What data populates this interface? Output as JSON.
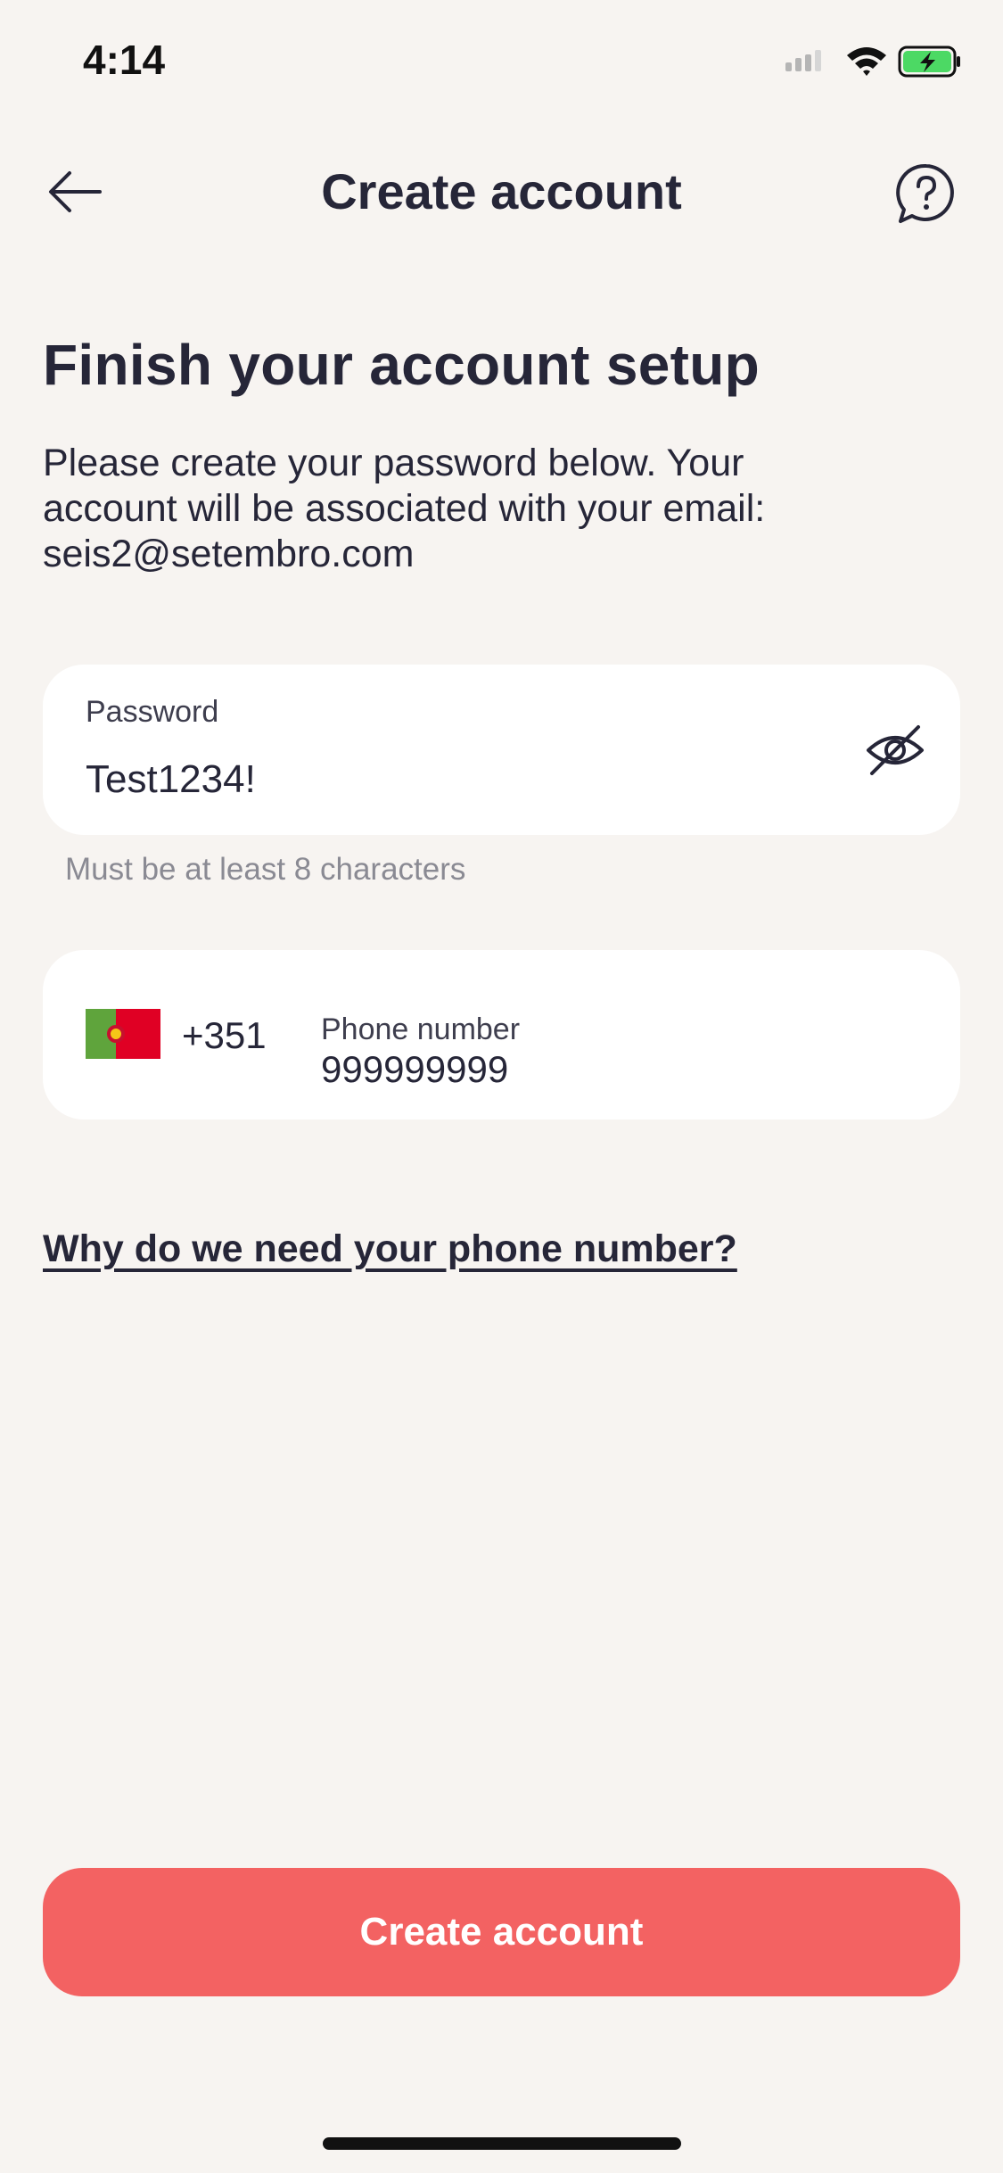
{
  "status_bar": {
    "time": "4:14",
    "icons": [
      "cellular-signal-icon",
      "wifi-icon",
      "battery-charging-icon"
    ]
  },
  "nav": {
    "title": "Create account",
    "back_icon": "arrow-left-icon",
    "help_icon": "help-bubble-icon"
  },
  "heading": "Finish your account setup",
  "intro": {
    "line1": "Please create your password below. Your",
    "line2": "account will be associated with your email:",
    "line3": "seis2@setembro.com"
  },
  "password_field": {
    "label": "Password",
    "value": "Test1234!",
    "visibility_icon": "eye-off-icon",
    "hint": "Must be at least 8 characters"
  },
  "phone_field": {
    "country_flag": "portugal-flag-icon",
    "dial_code": "+351",
    "label": "Phone number",
    "value": "999999999"
  },
  "why_link": "Why do we need your phone number?",
  "cta": {
    "label": "Create account"
  },
  "colors": {
    "background": "#F7F4F1",
    "card": "#FFFFFF",
    "text_primary": "#262638",
    "text_muted": "#8A8A93",
    "cta": "#F36262",
    "battery_fill": "#4CD964"
  }
}
